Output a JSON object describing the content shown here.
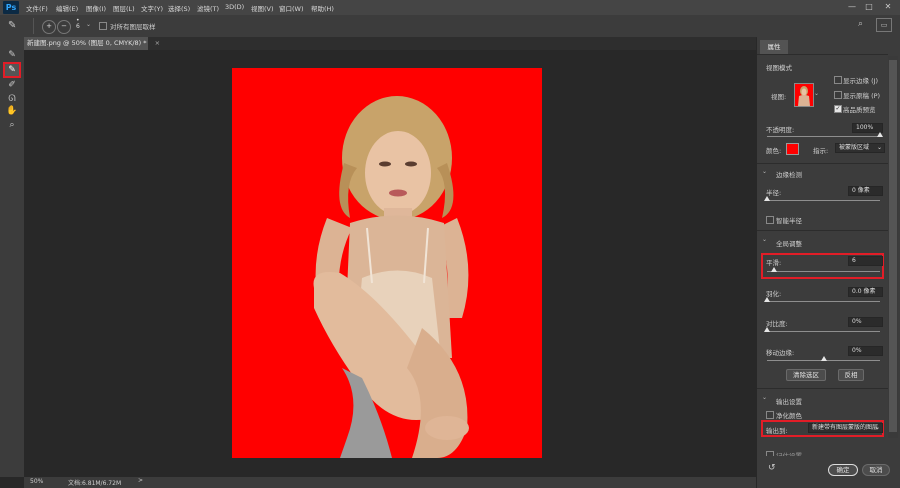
{
  "menubar": {
    "logo": "Ps",
    "items": [
      "文件(F)",
      "编辑(E)",
      "图像(I)",
      "图层(L)",
      "文字(Y)",
      "选择(S)",
      "滤镜(T)",
      "3D(D)",
      "视图(V)",
      "窗口(W)",
      "帮助(H)"
    ],
    "minimize": "—",
    "maximize": "□",
    "close": "✕"
  },
  "options": {
    "sample_all_layers": "对所有图层取样"
  },
  "document": {
    "tab_title": "新建图.png @ 50% (图层 0, CMYK/8) *",
    "tab_close": "×",
    "zoom": "50%",
    "doc_info": "文档:6.81M/6.72M",
    "status_arrow": ">"
  },
  "panel": {
    "tab": "属性",
    "view_mode": {
      "title": "视图模式",
      "view_label": "视图:",
      "show_edge": "显示边缘 (J)",
      "show_original": "显示原稿 (P)",
      "high_quality": "高品质预览"
    },
    "opacity_label": "不透明度:",
    "opacity_value": "100%",
    "opacity_level": 1.0,
    "color_label": "颜色:",
    "indicate_label": "指示:",
    "indicate_value": "被蒙版区域",
    "edge_detection": {
      "title": "边缘检测",
      "radius_label": "半径:",
      "radius_value": "0 像素",
      "radius_level": 0.0,
      "smart_radius": "智能半径"
    },
    "global_refine": {
      "title": "全局调整",
      "smooth_label": "平滑:",
      "smooth_value": "6",
      "smooth_level": 0.06,
      "feather_label": "羽化:",
      "feather_value": "0.0 像素",
      "feather_level": 0.0,
      "contrast_label": "对比度:",
      "contrast_value": "0%",
      "contrast_level": 0.0,
      "shift_label": "移动边缘:",
      "shift_value": "0%",
      "shift_level": 0.5,
      "clear_button": "清除选区",
      "invert_button": "反相"
    },
    "output": {
      "title": "输出设置",
      "decontaminate": "净化颜色",
      "output_to_label": "输出到:",
      "output_to_value": "新建带有图层蒙版的图层",
      "remember": "记住设置"
    },
    "ok": "确定",
    "cancel": "取消"
  },
  "colors": {
    "accent_red": "#e21d27",
    "canvas_red": "#ff0000",
    "swatch": "#ff0000"
  }
}
